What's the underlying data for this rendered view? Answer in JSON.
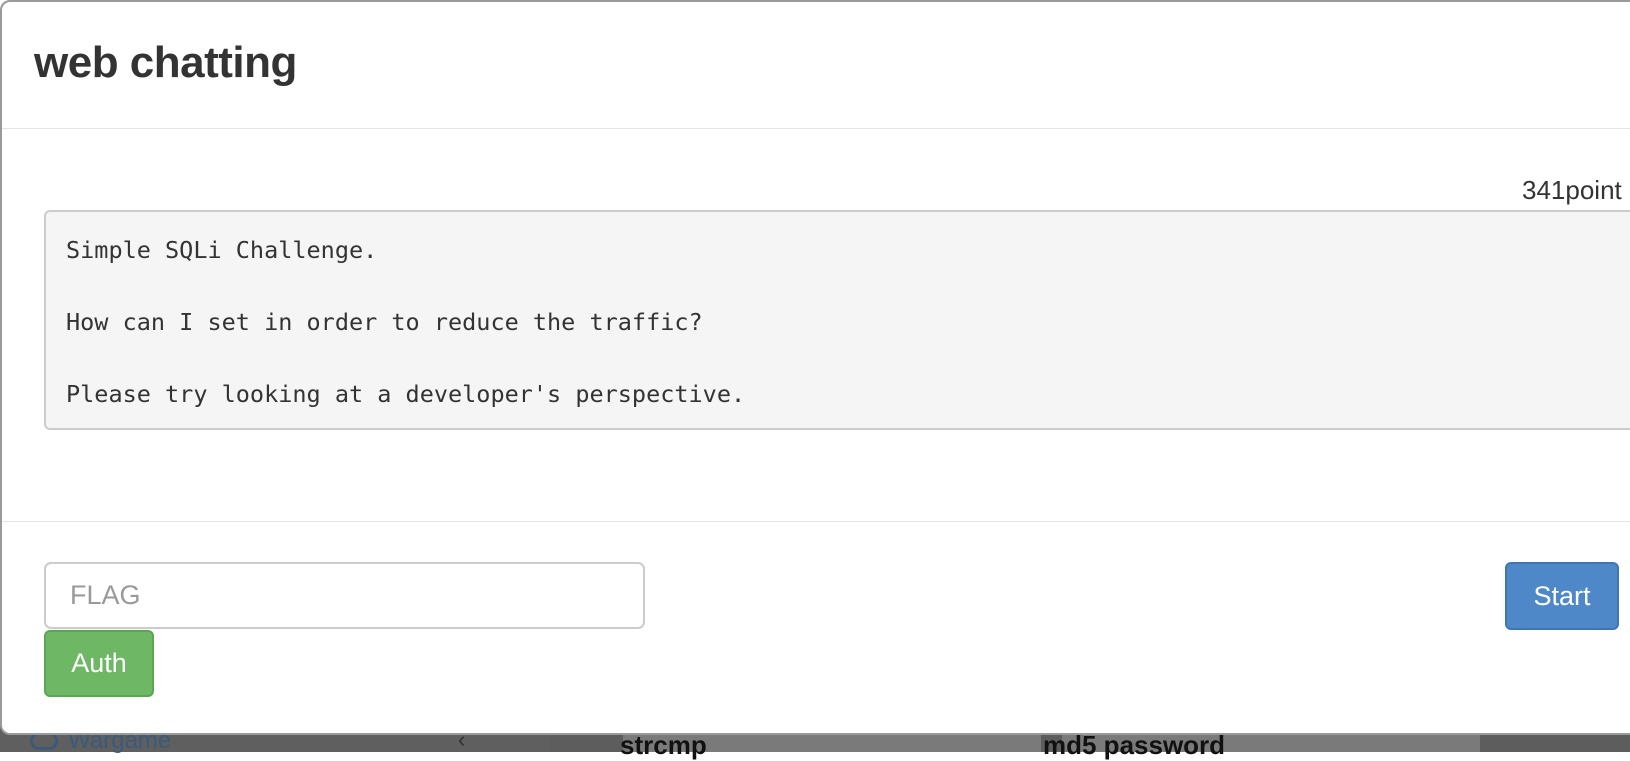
{
  "modal": {
    "title": "web chatting",
    "points": "341point",
    "description": "Simple SQLi Challenge.\n\nHow can I set in order to reduce the traffic?\n\nPlease try looking at a developer's perspective.",
    "flag_placeholder": "FLAG",
    "auth_label": "Auth",
    "start_label": "Start"
  },
  "background": {
    "sidebar_item": "Wargame",
    "cards": [
      "strcmp",
      "md5 password"
    ]
  },
  "colors": {
    "auth_button": "#6db765",
    "start_button": "#4f88c8",
    "description_bg": "#f5f5f5"
  },
  "icons": {
    "sidebar_item": "gamepad-icon",
    "sidebar_chevron": "chevron-left-icon"
  }
}
